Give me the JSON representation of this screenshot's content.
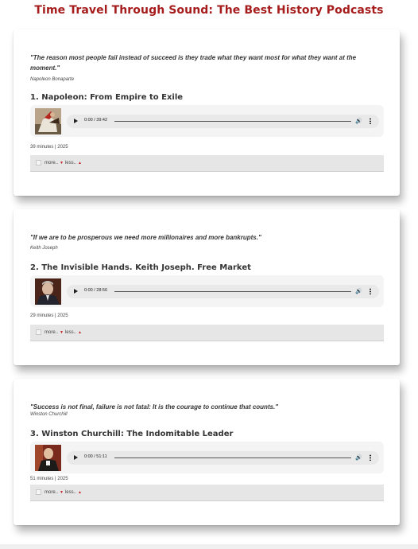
{
  "page": {
    "title": "Time Travel Through Sound: The Best History Podcasts"
  },
  "episodes": [
    {
      "quote": "\"The reason most people fail instead of succeed is they trade what they want most for what they want at the moment.\"",
      "author": "Napoleon Bonaparte",
      "title": "1. Napoleon: From Empire to Exile",
      "time": "0:00 / 39:42",
      "meta": "39 minutes | 2025",
      "more_label": "more..",
      "less_label": "less.."
    },
    {
      "quote": "\"If we are to be prosperous we need more millionaires and more bankrupts.\"",
      "author": "Keith Joseph",
      "title": "2. The Invisible Hands. Keith Joseph. Free Market",
      "time": "0:00 / 28:56",
      "meta": "29 minutes | 2025",
      "more_label": "more..",
      "less_label": "less.."
    },
    {
      "quote": "\"Success is not final, failure is not fatal: It is the courage to continue that counts.\"",
      "author": "Winston Churchill",
      "title": "3. Winston Churchill: The Indomitable Leader",
      "time": "0:00 / 51:11",
      "meta": "51 minutes | 2025",
      "more_label": "more..",
      "less_label": "less.."
    }
  ],
  "icons": {
    "play": "play-icon",
    "volume": "volume-icon",
    "menu": "more-options-icon",
    "expand": "expand-icon",
    "down": "arrow-down-icon",
    "up": "arrow-up-icon"
  },
  "colors": {
    "accent": "#a61c1c",
    "arrow": "#c0212a"
  }
}
